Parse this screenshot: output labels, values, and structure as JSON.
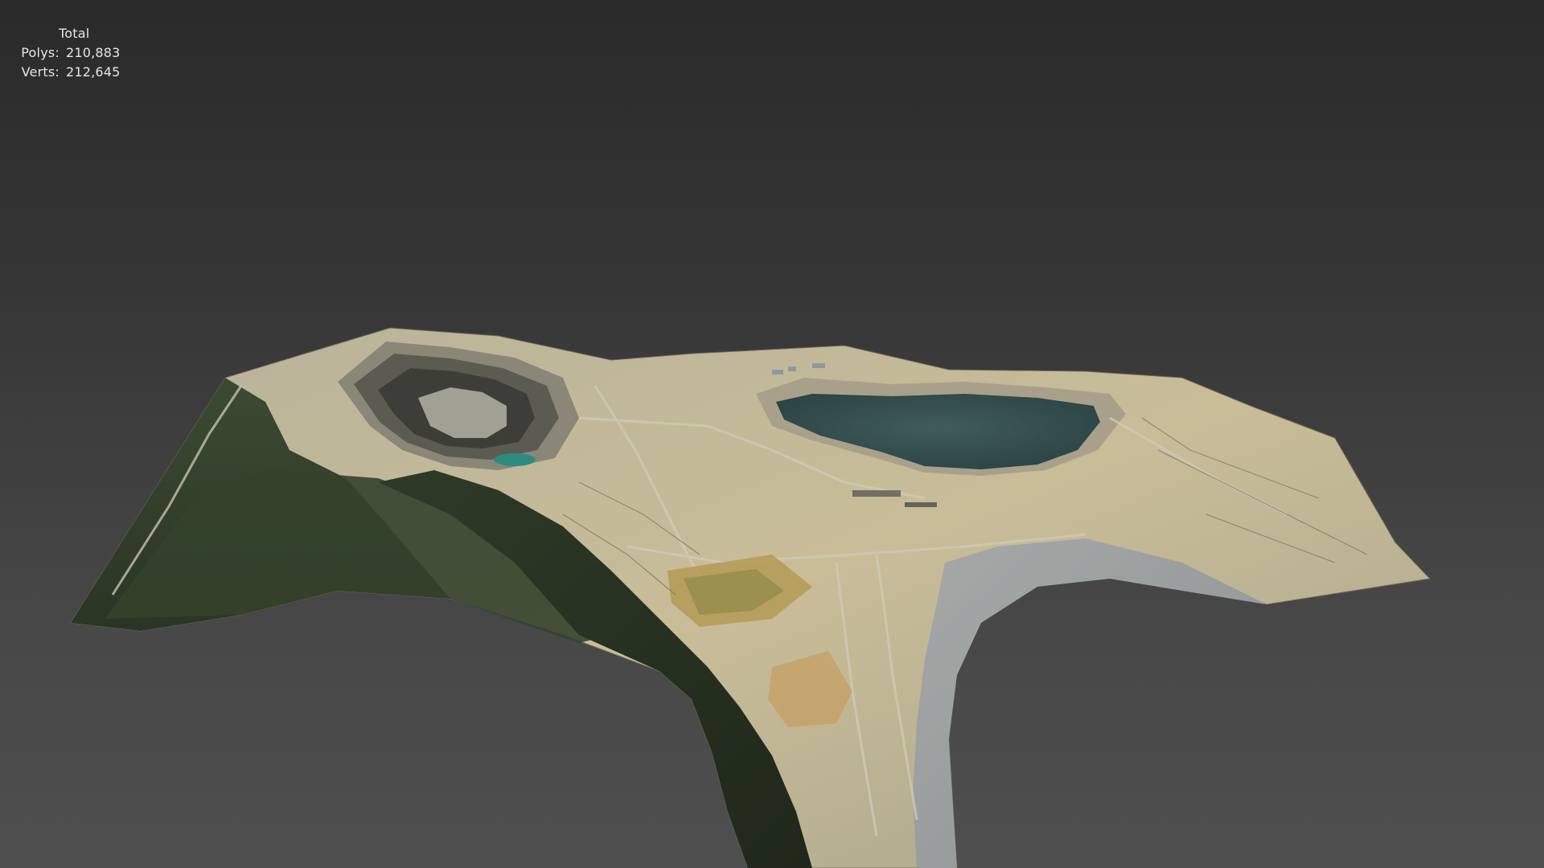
{
  "viewport": {
    "background_top": "#2a2a2a",
    "background_bottom": "#4f4f4f",
    "object": "terrain-mesh-open-pit-mine"
  },
  "stats": {
    "header": "Total",
    "polys_label": "Polys:",
    "polys_value": "210,883",
    "verts_label": "Verts:",
    "verts_value": "212,645"
  }
}
